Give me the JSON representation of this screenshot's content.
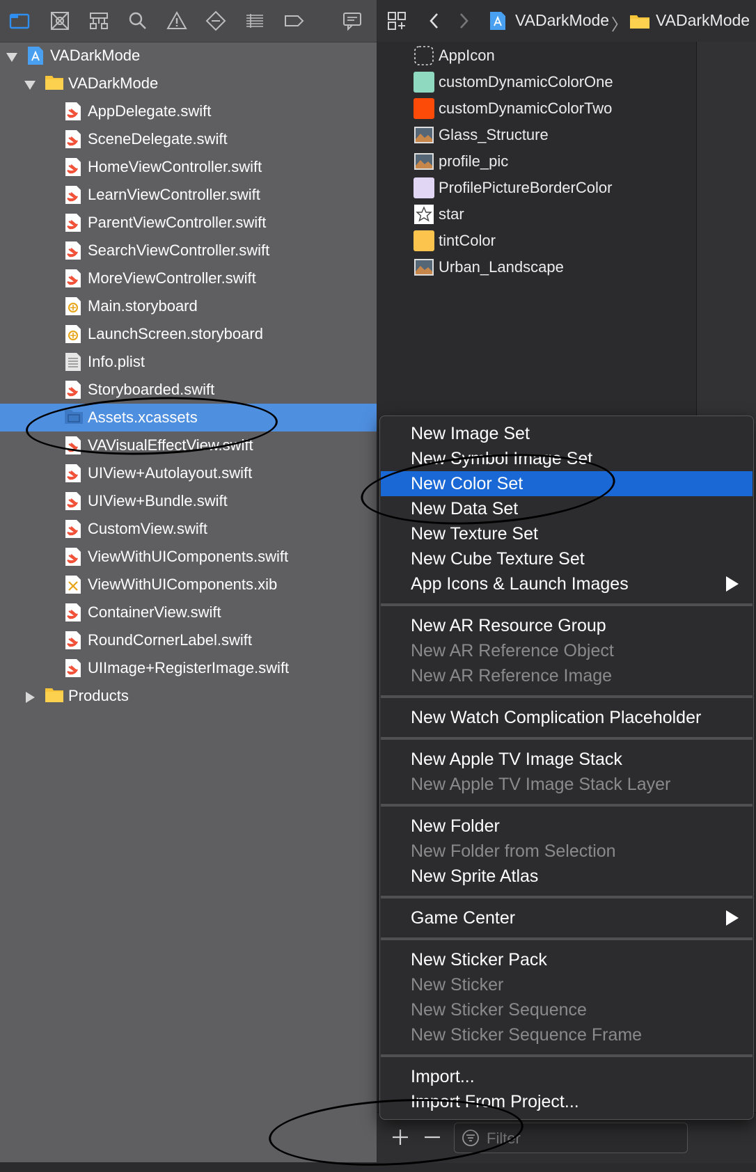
{
  "colors": {
    "navigator_bg": "#5f5f61",
    "selection": "#4f8fe0",
    "menu_highlight": "#1a68d6",
    "swatch_custom_one": "#8fd9c0",
    "swatch_custom_two": "#fc4a08",
    "swatch_profile_border": "#e2d6f5",
    "swatch_tint": "#fcc44c"
  },
  "toolbar_icons": [
    "folder-icon",
    "source-control-icon",
    "hierarchy-icon",
    "search-icon",
    "warning-icon",
    "test-icon",
    "debug-icon",
    "breakpoint-icon",
    "report-icon"
  ],
  "tree": {
    "project": "VADarkMode",
    "group": "VADarkMode",
    "files": [
      {
        "label": "AppDelegate.swift",
        "type": "swift"
      },
      {
        "label": "SceneDelegate.swift",
        "type": "swift"
      },
      {
        "label": "HomeViewController.swift",
        "type": "swift"
      },
      {
        "label": "LearnViewController.swift",
        "type": "swift"
      },
      {
        "label": "ParentViewController.swift",
        "type": "swift"
      },
      {
        "label": "SearchViewController.swift",
        "type": "swift"
      },
      {
        "label": "MoreViewController.swift",
        "type": "swift"
      },
      {
        "label": "Main.storyboard",
        "type": "storyboard"
      },
      {
        "label": "LaunchScreen.storyboard",
        "type": "storyboard"
      },
      {
        "label": "Info.plist",
        "type": "plist"
      },
      {
        "label": "Storyboarded.swift",
        "type": "swift"
      },
      {
        "label": "Assets.xcassets",
        "type": "assets",
        "selected": true
      },
      {
        "label": "VAVisualEffectView.swift",
        "type": "swift"
      },
      {
        "label": "UIView+Autolayout.swift",
        "type": "swift"
      },
      {
        "label": "UIView+Bundle.swift",
        "type": "swift"
      },
      {
        "label": "CustomView.swift",
        "type": "swift"
      },
      {
        "label": "ViewWithUIComponents.swift",
        "type": "swift"
      },
      {
        "label": "ViewWithUIComponents.xib",
        "type": "xib"
      },
      {
        "label": "ContainerView.swift",
        "type": "swift"
      },
      {
        "label": "RoundCornerLabel.swift",
        "type": "swift"
      },
      {
        "label": "UIImage+RegisterImage.swift",
        "type": "swift"
      }
    ],
    "products": "Products"
  },
  "breadcrumb": {
    "project": "VADarkMode",
    "group": "VADarkMode"
  },
  "assets": [
    {
      "label": "AppIcon",
      "kind": "appicon"
    },
    {
      "label": "customDynamicColorOne",
      "kind": "color",
      "color": "#8fd9c0"
    },
    {
      "label": "customDynamicColorTwo",
      "kind": "color",
      "color": "#fc4a08"
    },
    {
      "label": "Glass_Structure",
      "kind": "image"
    },
    {
      "label": "profile_pic",
      "kind": "image"
    },
    {
      "label": "ProfilePictureBorderColor",
      "kind": "color",
      "color": "#e2d6f5"
    },
    {
      "label": "star",
      "kind": "star"
    },
    {
      "label": "tintColor",
      "kind": "color",
      "color": "#fcc44c"
    },
    {
      "label": "Urban_Landscape",
      "kind": "image"
    }
  ],
  "menu": {
    "groups": [
      [
        {
          "label": "New Image Set",
          "enabled": true
        },
        {
          "label": "New Symbol Image Set",
          "enabled": true
        },
        {
          "label": "New Color Set",
          "enabled": true,
          "highlighted": true
        },
        {
          "label": "New Data Set",
          "enabled": true
        },
        {
          "label": "New Texture Set",
          "enabled": true
        },
        {
          "label": "New Cube Texture Set",
          "enabled": true
        },
        {
          "label": "App Icons & Launch Images",
          "enabled": true,
          "submenu": true
        }
      ],
      [
        {
          "label": "New AR Resource Group",
          "enabled": true
        },
        {
          "label": "New AR Reference Object",
          "enabled": false
        },
        {
          "label": "New AR Reference Image",
          "enabled": false
        }
      ],
      [
        {
          "label": "New Watch Complication Placeholder",
          "enabled": true
        }
      ],
      [
        {
          "label": "New Apple TV Image Stack",
          "enabled": true
        },
        {
          "label": "New Apple TV Image Stack Layer",
          "enabled": false
        }
      ],
      [
        {
          "label": "New Folder",
          "enabled": true
        },
        {
          "label": "New Folder from Selection",
          "enabled": false
        },
        {
          "label": "New Sprite Atlas",
          "enabled": true
        }
      ],
      [
        {
          "label": "Game Center",
          "enabled": true,
          "submenu": true
        }
      ],
      [
        {
          "label": "New Sticker Pack",
          "enabled": true
        },
        {
          "label": "New Sticker",
          "enabled": false
        },
        {
          "label": "New Sticker Sequence",
          "enabled": false
        },
        {
          "label": "New Sticker Sequence Frame",
          "enabled": false
        }
      ],
      [
        {
          "label": "Import...",
          "enabled": true
        },
        {
          "label": "Import From Project...",
          "enabled": true
        }
      ]
    ]
  },
  "bottom": {
    "filter_placeholder": "Filter"
  }
}
